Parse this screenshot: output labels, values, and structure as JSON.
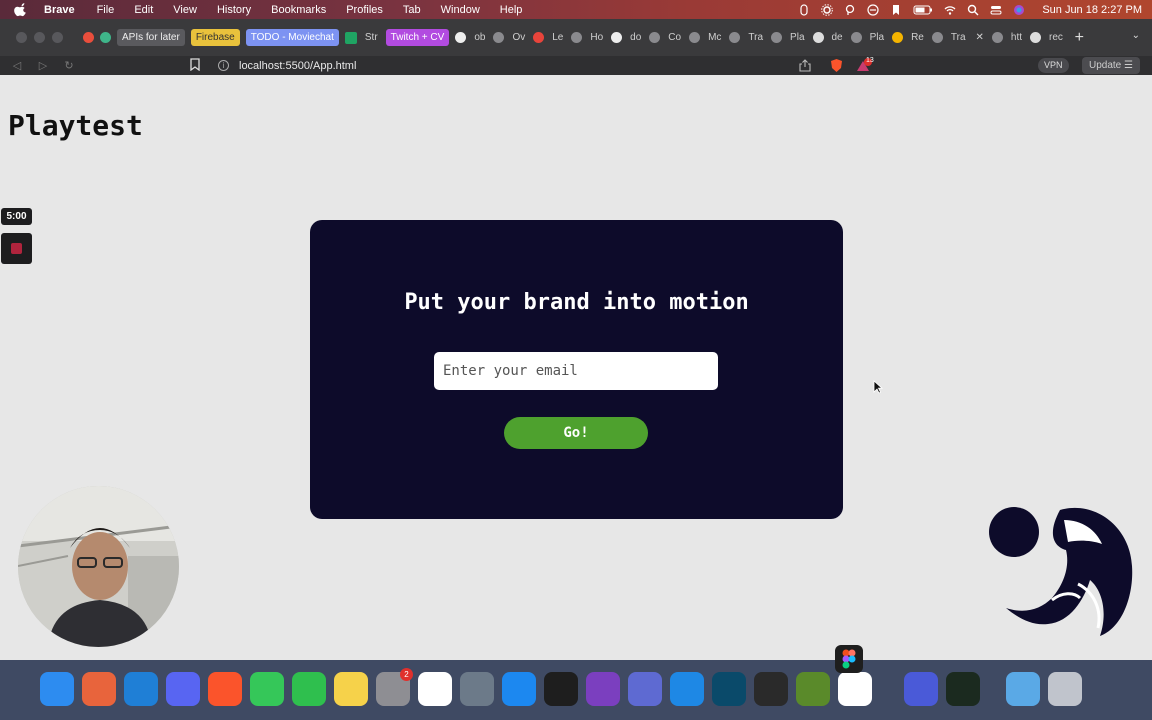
{
  "menubar": {
    "app": "Brave",
    "items": [
      "File",
      "Edit",
      "View",
      "History",
      "Bookmarks",
      "Profiles",
      "Tab",
      "Window",
      "Help"
    ],
    "clock": "Sun Jun 18  2:27 PM"
  },
  "tabs": {
    "bookmarks": [
      {
        "label": "APIs for later",
        "style": "plain"
      },
      {
        "label": "Firebase",
        "style": "yellow"
      },
      {
        "label": "TODO - Moviechat",
        "style": "blue"
      },
      {
        "label": "Str",
        "style": "txt"
      },
      {
        "label": "Twitch + CV",
        "style": "purple"
      }
    ],
    "short_tabs": [
      "ob",
      "Ov",
      "Le",
      "Ho",
      "do",
      "Co",
      "Mc",
      "Tra",
      "Pla",
      "de",
      "Pla",
      "Re",
      "Tra",
      "htt",
      "rec"
    ]
  },
  "toolbar": {
    "url": "localhost:5500/App.html",
    "vpn_label": "VPN",
    "update_label": "Update",
    "rewards_badge": "13"
  },
  "page": {
    "title": "Playtest",
    "card": {
      "heading": "Put your brand into motion",
      "email_placeholder": "Enter your email",
      "button_label": "Go!"
    }
  },
  "recording": {
    "timer": "5:00"
  },
  "dock": {
    "apps": [
      {
        "name": "finder-icon",
        "color": "#2d8cf0"
      },
      {
        "name": "launchpad-icon",
        "color": "#e8643c"
      },
      {
        "name": "vscode-icon",
        "color": "#1f7fd6"
      },
      {
        "name": "discord-icon",
        "color": "#5865f2"
      },
      {
        "name": "brave-icon",
        "color": "#fb542b"
      },
      {
        "name": "messages-icon",
        "color": "#35c759"
      },
      {
        "name": "facetime-icon",
        "color": "#2fbf4e"
      },
      {
        "name": "notes-icon",
        "color": "#f6d24a"
      },
      {
        "name": "system-settings-icon",
        "color": "#8e8e93",
        "badge": "2"
      },
      {
        "name": "notion-icon",
        "color": "#ffffff"
      },
      {
        "name": "preview-icon",
        "color": "#6c7a89"
      },
      {
        "name": "xcode-icon",
        "color": "#1c88f0"
      },
      {
        "name": "terminal-icon",
        "color": "#1e1e1e"
      },
      {
        "name": "github-desktop-icon",
        "color": "#7b3fbf"
      },
      {
        "name": "linear-icon",
        "color": "#5e6ad2"
      },
      {
        "name": "app-store-icon",
        "color": "#1e88e5"
      },
      {
        "name": "league-icon",
        "color": "#0a4a6a"
      },
      {
        "name": "obs-icon",
        "color": "#2a2a2a"
      },
      {
        "name": "minecraft-icon",
        "color": "#5a8a2a"
      },
      {
        "name": "slack-icon",
        "color": "#ffffff"
      },
      {
        "name": "spark-icon",
        "color": "#4a5ad8"
      },
      {
        "name": "activity-monitor-icon",
        "color": "#1b2a1f"
      },
      {
        "name": "folder-icon",
        "color": "#5aa9e6"
      },
      {
        "name": "trash-icon",
        "color": "#c0c4cc"
      }
    ]
  }
}
